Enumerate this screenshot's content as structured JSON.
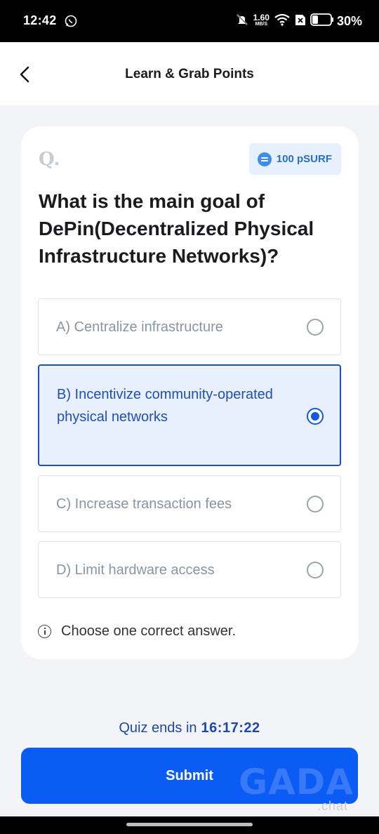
{
  "status_bar": {
    "time": "12:42",
    "net_speed_value": "1.60",
    "net_speed_unit": "MB/S",
    "battery": "30%"
  },
  "header": {
    "title": "Learn & Grab Points"
  },
  "quiz": {
    "q_label": "Q.",
    "reward": "100 pSURF",
    "question": "What is the main goal of DePin(Decentralized Physical Infrastructure Networks)?",
    "options": [
      {
        "label": "A) Centralize infrastructure",
        "selected": false
      },
      {
        "label": "B) Incentivize community-operated physical networks",
        "selected": true
      },
      {
        "label": "C) Increase transaction fees",
        "selected": false
      },
      {
        "label": "D) Limit hardware access",
        "selected": false
      }
    ],
    "hint": "Choose one correct answer."
  },
  "footer": {
    "timer_label": "Quiz ends in",
    "timer_value": "16:17:22",
    "submit_label": "Submit",
    "watermark": "GADA",
    "watermark_sub": ".chat"
  },
  "colors": {
    "accent": "#0b5cf5",
    "selected_bg": "#e8effd",
    "selected_text": "#1f4fb8",
    "card_bg": "#ffffff",
    "page_bg": "#f2f4f7"
  }
}
